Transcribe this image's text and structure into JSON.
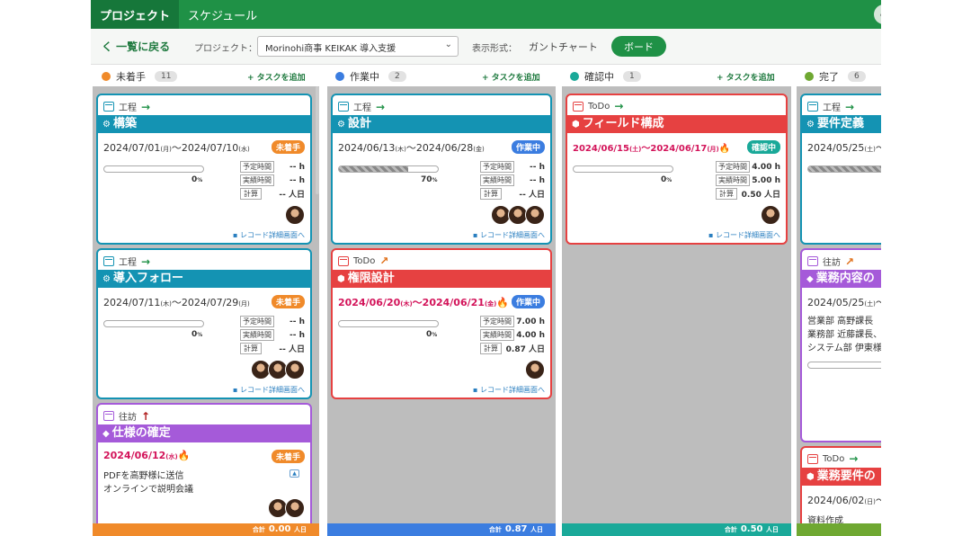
{
  "header": {
    "tabs": [
      {
        "label": "プロジェクト"
      },
      {
        "label": "スケジュール"
      }
    ],
    "link_icon": "∞"
  },
  "toolbar": {
    "back_label": "く 一覧に戻る",
    "project_label": "プロジェクト：",
    "project_value": "Morinohi商事 KEIKAK 導入支援",
    "view_label": "表示形式：",
    "view_gantt": "ガントチャート",
    "view_board": "ボード"
  },
  "colors": {
    "not_started": "#f08a2a",
    "in_progress": "#3b7de0",
    "review": "#1aa999",
    "done": "#6fa832",
    "teal": "#1493b3",
    "red": "#e64141",
    "purple": "#a55ad9"
  },
  "columns": [
    {
      "name": "未着手",
      "count": "11",
      "add": "+ タスクを追加",
      "footer_label": "合計",
      "footer_value": "0.00",
      "footer_unit": "人日"
    },
    {
      "name": "作業中",
      "count": "2",
      "add": "+ タスクを追加",
      "footer_label": "合計",
      "footer_value": "0.87",
      "footer_unit": "人日"
    },
    {
      "name": "確認中",
      "count": "1",
      "add": "+ タスクを追加",
      "footer_label": "合計",
      "footer_value": "0.50",
      "footer_unit": "人日"
    },
    {
      "name": "完了",
      "count": "6",
      "add": "+ タスクを追加",
      "footer_label": "合計",
      "footer_value": "",
      "footer_unit": ""
    }
  ],
  "cards": [
    {
      "type": "工程",
      "arrow": "→",
      "title": "構築",
      "title_icon": "⚙",
      "start": "2024/07/01",
      "sdow": "(月)",
      "sep": "～",
      "end": "2024/07/10",
      "edow": "(水)",
      "badge": "未着手",
      "progress": 0,
      "pct": "0",
      "plan": "-- h",
      "actual": "-- h",
      "calc": "-- 人日",
      "link": "レコード詳細画面へ"
    },
    {
      "type": "工程",
      "arrow": "→",
      "title": "導入フォロー",
      "title_icon": "⚙",
      "start": "2024/07/11",
      "sdow": "(木)",
      "sep": "～",
      "end": "2024/07/29",
      "edow": "(月)",
      "badge": "未着手",
      "progress": 0,
      "pct": "0",
      "plan": "-- h",
      "actual": "-- h",
      "calc": "-- 人日",
      "link": "レコード詳細画面へ"
    },
    {
      "type": "往訪",
      "arrow": "↑",
      "title": "仕様の確定",
      "title_icon": "◆",
      "start": "2024/06/12",
      "sdow": "(水)",
      "fire": "🔥",
      "badge": "未着手",
      "memo1": "PDFを高野様に送信",
      "memo2": "オンラインで説明会議"
    },
    {
      "type": "工程",
      "arrow": "→",
      "title": "設計",
      "title_icon": "⚙",
      "start": "2024/06/13",
      "sdow": "(木)",
      "sep": "～",
      "end": "2024/06/28",
      "edow": "(金)",
      "badge": "作業中",
      "progress": 70,
      "pct": "70",
      "plan": "-- h",
      "actual": "-- h",
      "calc": "-- 人日",
      "link": "レコード詳細画面へ"
    },
    {
      "type": "ToDo",
      "arrow": "↗",
      "title": "権限設計",
      "title_icon": "⬢",
      "start": "2024/06/20",
      "sdow": "(木)",
      "sep": "～",
      "end": "2024/06/21",
      "edow": "(金)",
      "fire": "🔥",
      "badge": "作業中",
      "progress": 0,
      "pct": "0",
      "plan": "7.00 h",
      "actual": "4.00 h",
      "calc": "0.87 人日",
      "link": "レコード詳細画面へ"
    },
    {
      "type": "ToDo",
      "arrow": "→",
      "title": "フィールド構成",
      "title_icon": "⬢",
      "start": "2024/06/15",
      "sdow": "(土)",
      "sep": "～",
      "end": "2024/06/17",
      "edow": "(月)",
      "fire": "🔥",
      "badge": "確認中",
      "progress": 0,
      "pct": "0",
      "plan": "4.00 h",
      "actual": "5.00 h",
      "calc": "0.50 人日",
      "link": "レコード詳細画面へ"
    },
    {
      "type": "工程",
      "arrow": "→",
      "title": "要件定義",
      "title_icon": "⚙",
      "start": "2024/05/25",
      "sdow": "(土)",
      "sep": "～"
    },
    {
      "type": "往訪",
      "arrow": "↗",
      "title": "業務内容の",
      "title_icon": "◆",
      "start": "2024/05/25",
      "sdow": "(土)",
      "sep": "～",
      "memo1": "営業部 高野課長",
      "memo2": "業務部 近藤課長、",
      "memo3": "システム部 伊東様"
    },
    {
      "type": "ToDo",
      "arrow": "→",
      "title": "業務要件の",
      "title_icon": "⬢",
      "start": "2024/06/02",
      "sdow": "(日)",
      "sep": "～",
      "memo1": "資料作成"
    }
  ],
  "stat_labels": {
    "plan": "予定時間",
    "actual": "実績時間",
    "calc": "計算"
  }
}
